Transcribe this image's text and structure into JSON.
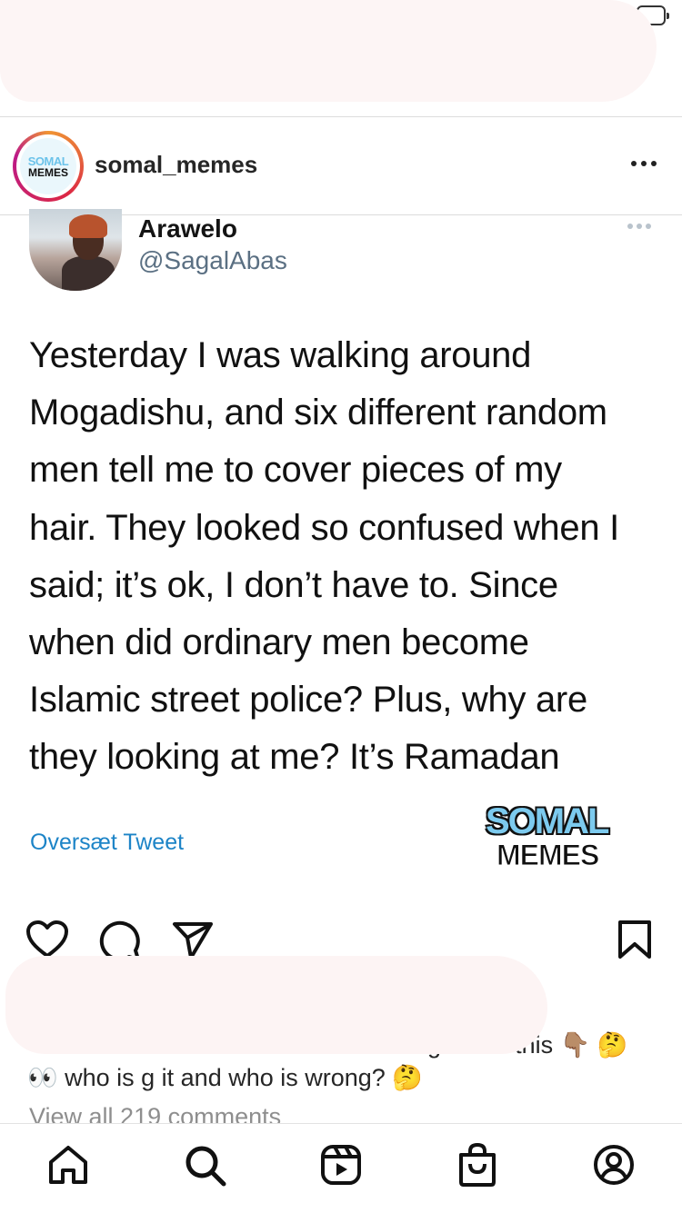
{
  "post": {
    "username": "somal_memes",
    "avatar_logo": {
      "line1": "SOMAL",
      "line2": "MEMES"
    }
  },
  "tweet": {
    "name": "Arawelo",
    "handle": "@SagalAbas",
    "text_lines": [
      "Yesterday I was walking around",
      "Mogadishu, and six different random",
      "men tell me to cover pieces of my",
      "hair. They looked so confused when I",
      "said; it’s ok, I don’t have to. Since",
      "when did ordinary men become",
      "Islamic street police?  Plus, why are",
      "they looking at me? It’s Ramadan"
    ],
    "translate_link": "Oversæt Tweet"
  },
  "watermark": {
    "line1": "SOMAL",
    "line2": "MEMES"
  },
  "caption": {
    "line1": "oughts on this 👇🏽 🤔",
    "line2": "👀 who is  g  it and who is wrong? 🤔",
    "view_all": "View all 219 comments"
  },
  "icons": {
    "like": "heart-icon",
    "comment": "comment-icon",
    "share": "share-icon",
    "save": "bookmark-icon",
    "nav": [
      "home-icon",
      "search-icon",
      "reels-icon",
      "shop-icon",
      "profile-icon"
    ]
  },
  "colors": {
    "handle": "#5b7083",
    "link": "#1d84c7",
    "muted": "#8e8e8e"
  }
}
